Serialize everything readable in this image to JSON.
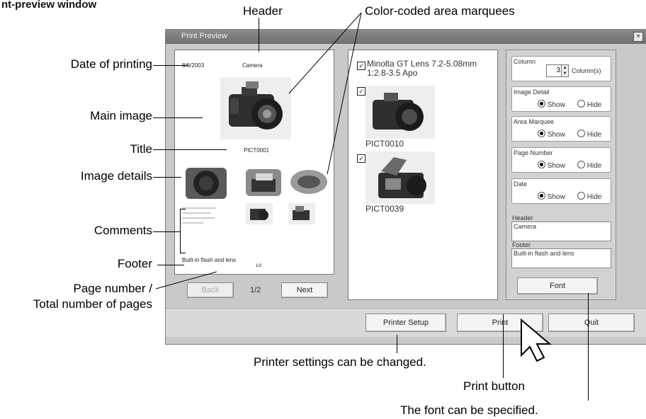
{
  "section_heading": "nt-preview window",
  "callouts": {
    "header": "Header",
    "marquees": "Color-coded area marquees",
    "date": "Date of printing",
    "main_image": "Main image",
    "title": "Title",
    "image_details": "Image details",
    "comments": "Comments",
    "footer": "Footer",
    "page_number_1": "Page number /",
    "page_number_2": "Total number of pages",
    "printer_setup": "Printer settings can be changed.",
    "print_button": "Print button",
    "font": "The font can be specified."
  },
  "window": {
    "title": "Print Preview",
    "close_glyph": "×"
  },
  "preview_page": {
    "date": "8/6/2003",
    "header": "Camera",
    "title": "PICT0001",
    "footer": "Built-in flash and lens",
    "page_number": "1/2"
  },
  "nav": {
    "back_label": "Back",
    "page_indicator": "1/2",
    "next_label": "Next"
  },
  "image_list": {
    "items": [
      {
        "checked": true,
        "caption_line1": "Minolta GT Lens 7.2-5.08mm",
        "caption_line2": "1:2.8-3.5 Apo"
      },
      {
        "checked": true,
        "caption_line1": "PICT0010"
      },
      {
        "checked": true,
        "caption_line1": "PICT0039"
      }
    ]
  },
  "options": {
    "column": {
      "label": "Column",
      "value": "3",
      "unit": "Column(s)"
    },
    "image_detail": {
      "label": "Image Detail",
      "show": "Show",
      "hide": "Hide",
      "selected": "Show"
    },
    "area_marquee": {
      "label": "Area Marquee",
      "show": "Show",
      "hide": "Hide",
      "selected": "Show"
    },
    "page_number": {
      "label": "Page Number",
      "show": "Show",
      "hide": "Hide",
      "selected": "Show"
    },
    "date": {
      "label": "Date",
      "show": "Show",
      "hide": "Hide",
      "selected": "Show"
    },
    "header": {
      "label": "Header",
      "value": "Camera"
    },
    "footer": {
      "label": "Footer",
      "value": "Built-in flash and lens"
    },
    "font_button": "Font"
  },
  "bottom_buttons": {
    "printer_setup": "Printer Setup",
    "print": "Print",
    "quit": "Quit"
  }
}
